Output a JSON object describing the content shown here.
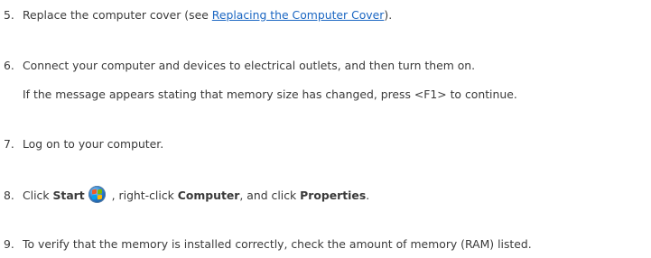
{
  "steps": [
    {
      "num": "5.",
      "text_before": "Replace the computer cover (see ",
      "link": "Replacing the Computer Cover",
      "text_after": ")."
    },
    {
      "num": "6.",
      "text": "Connect your computer and devices to electrical outlets, and then turn them on.",
      "note": "If the message appears stating that memory size has changed, press <F1> to continue."
    },
    {
      "num": "7.",
      "text": "Log on to your computer."
    },
    {
      "num": "8.",
      "text_click": "Click ",
      "bold_start": "Start",
      "icon": "windows-start-orb-icon",
      "text_mid": " , right-click ",
      "bold_computer": "Computer",
      "text_and": ", and click ",
      "bold_properties": "Properties",
      "text_end": "."
    },
    {
      "num": "9.",
      "text": "To verify that the memory is installed correctly, check the amount of memory (RAM) listed."
    }
  ],
  "colors": {
    "text": "#3a3a3a",
    "link": "#1a66c2",
    "background": "#ffffff"
  }
}
